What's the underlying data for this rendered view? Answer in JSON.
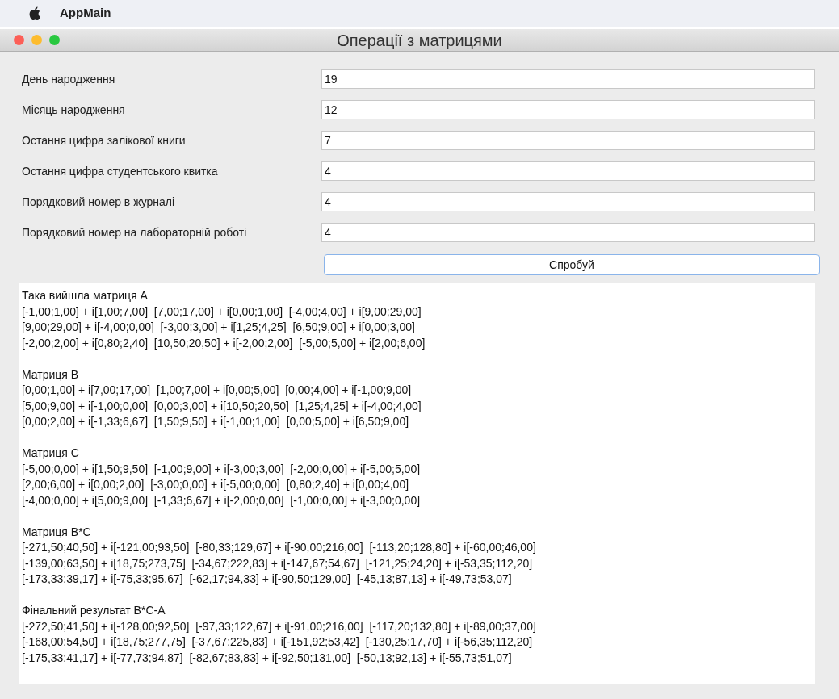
{
  "menu_bar": {
    "app_name": "AppMain"
  },
  "window": {
    "title": "Операції з матрицями"
  },
  "form": {
    "fields": [
      {
        "label": "День народження",
        "value": "19"
      },
      {
        "label": "Місяць народження",
        "value": "12"
      },
      {
        "label": "Остання цифра залікової книги",
        "value": "7"
      },
      {
        "label": "Остання цифра студентського квитка",
        "value": "4"
      },
      {
        "label": "Порядковий номер в журналі",
        "value": "4"
      },
      {
        "label": "Порядковий номер на лабораторній роботі",
        "value": "4"
      }
    ],
    "button": "Спробуй"
  },
  "output": [
    {
      "title": "Така вийшла матриця А",
      "lines": [
        "[-1,00;1,00] + i[1,00;7,00]  [7,00;17,00] + i[0,00;1,00]  [-4,00;4,00] + i[9,00;29,00]",
        "[9,00;29,00] + i[-4,00;0,00]  [-3,00;3,00] + i[1,25;4,25]  [6,50;9,00] + i[0,00;3,00]",
        "[-2,00;2,00] + i[0,80;2,40]  [10,50;20,50] + i[-2,00;2,00]  [-5,00;5,00] + i[2,00;6,00]"
      ]
    },
    {
      "title": "Матриця В",
      "lines": [
        "[0,00;1,00] + i[7,00;17,00]  [1,00;7,00] + i[0,00;5,00]  [0,00;4,00] + i[-1,00;9,00]",
        "[5,00;9,00] + i[-1,00;0,00]  [0,00;3,00] + i[10,50;20,50]  [1,25;4,25] + i[-4,00;4,00]",
        "[0,00;2,00] + i[-1,33;6,67]  [1,50;9,50] + i[-1,00;1,00]  [0,00;5,00] + i[6,50;9,00]"
      ]
    },
    {
      "title": "Матриця С",
      "lines": [
        "[-5,00;0,00] + i[1,50;9,50]  [-1,00;9,00] + i[-3,00;3,00]  [-2,00;0,00] + i[-5,00;5,00]",
        "[2,00;6,00] + i[0,00;2,00]  [-3,00;0,00] + i[-5,00;0,00]  [0,80;2,40] + i[0,00;4,00]",
        "[-4,00;0,00] + i[5,00;9,00]  [-1,33;6,67] + i[-2,00;0,00]  [-1,00;0,00] + i[-3,00;0,00]"
      ]
    },
    {
      "title": "Матриця В*С",
      "lines": [
        "[-271,50;40,50] + i[-121,00;93,50]  [-80,33;129,67] + i[-90,00;216,00]  [-113,20;128,80] + i[-60,00;46,00]",
        "[-139,00;63,50] + i[18,75;273,75]  [-34,67;222,83] + i[-147,67;54,67]  [-121,25;24,20] + i[-53,35;112,20]",
        "[-173,33;39,17] + i[-75,33;95,67]  [-62,17;94,33] + i[-90,50;129,00]  [-45,13;87,13] + i[-49,73;53,07]"
      ]
    },
    {
      "title": "Фінальний результат В*С-А",
      "lines": [
        "[-272,50;41,50] + i[-128,00;92,50]  [-97,33;122,67] + i[-91,00;216,00]  [-117,20;132,80] + i[-89,00;37,00]",
        "[-168,00;54,50] + i[18,75;277,75]  [-37,67;225,83] + i[-151,92;53,42]  [-130,25;17,70] + i[-56,35;112,20]",
        "[-175,33;41,17] + i[-77,73;94,87]  [-82,67;83,83] + i[-92,50;131,00]  [-50,13;92,13] + i[-55,73;51,07]"
      ]
    }
  ]
}
